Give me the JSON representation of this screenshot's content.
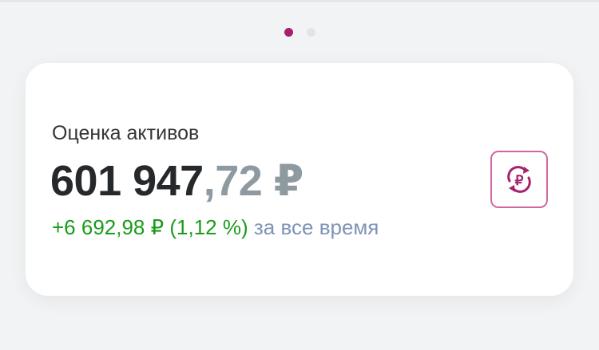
{
  "pager": {
    "count": 2,
    "active_index": 0
  },
  "card": {
    "title": "Оценка активов",
    "amount_integer": "601 947",
    "amount_fraction": ",72 ₽",
    "change_value": "+6 692,98 ₽ (1,12 %)",
    "change_period": "за все время",
    "currency_button_icon": "ruble-exchange-icon"
  },
  "colors": {
    "accent": "#a5216c",
    "positive": "#1a9b1a",
    "muted_blue": "#7f93b7"
  }
}
